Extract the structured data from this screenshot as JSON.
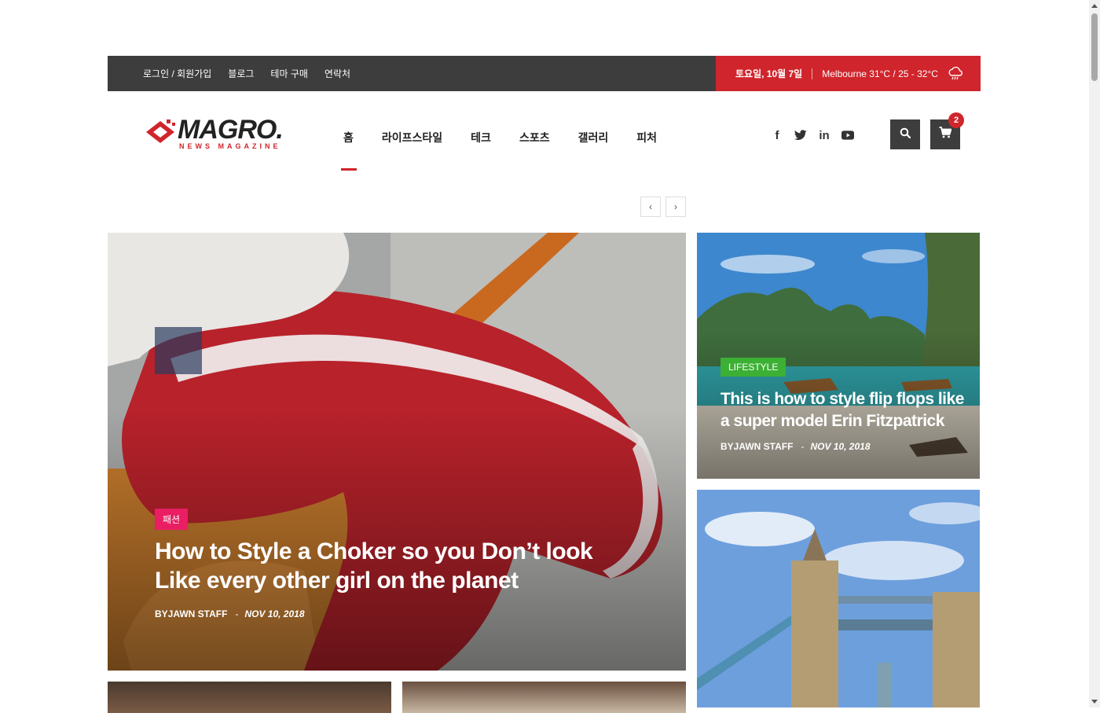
{
  "topbar": {
    "links": [
      "로그인 / 회원가입",
      "블로그",
      "테마 구매",
      "연락처"
    ],
    "date": "토요일, 10월 7일",
    "weather": "Melbourne 31°C / 25 - 32°C",
    "weather_icon": "cloud-rain-icon",
    "accent_color": "#d0252c"
  },
  "logo": {
    "word": "MAGRO.",
    "sub": "NEWS MAGAZINE"
  },
  "nav": {
    "items": [
      "홈",
      "라이프스타일",
      "테크",
      "스포츠",
      "갤러리",
      "피처"
    ],
    "active_index": 0
  },
  "social": {
    "icons": [
      "facebook-icon",
      "twitter-icon",
      "linkedin-icon",
      "youtube-icon"
    ],
    "glyphs": [
      "f",
      "t",
      "in",
      "▶"
    ]
  },
  "cart": {
    "count": "2"
  },
  "slider": {
    "prev": "‹",
    "next": "›"
  },
  "hero": {
    "category": "패션",
    "category_color": "#e91e63",
    "title_line1": "How to Style a Choker so you Don’t look",
    "title_line2": "Like every other girl on the planet",
    "author": "BYJAWN STAFF",
    "dash": "-",
    "date": "NOV 10, 2018"
  },
  "side1": {
    "category": "LIFESTYLE",
    "category_color": "#3cb034",
    "title_line1": "This is how to style flip flops like",
    "title_line2": "a super model Erin Fitzpatrick",
    "author": "BYJAWN STAFF",
    "dash": "-",
    "date": "NOV 10, 2018"
  }
}
